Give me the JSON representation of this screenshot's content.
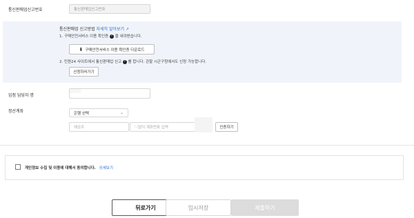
{
  "form": {
    "reg_number_label": "통신판매업신고번호",
    "reg_number_value": "통신판매업신고번호",
    "info_box": {
      "title": "통신판매업 신고방법",
      "title_link": "자세히 알아보기",
      "step1": "1. 구매안전서비스 이용 확인증",
      "step1_tail": "을 내려받습니다.",
      "download_button": "구매안전서비스 이용 확인증 다운로드",
      "step2": "2. 민원24 사이트에서 통신판매업 신고",
      "step2_tail": "를 합니다. 관할 시군구청에서도 신청 가능합니다.",
      "apply_button": "신청하러가기"
    },
    "manager_label": "입점 담당자 명",
    "settlement_label": "정산계좌",
    "bank_select": "은행 선택",
    "account_holder_placeholder": "예금주",
    "account_number_placeholder": "'-'없이 계좌번호 입력",
    "verify_button": "인증하기"
  },
  "consent": {
    "text": "개인정보 수집 및 이용에 대해서 동의합니다.",
    "link": "상세보기"
  },
  "actions": {
    "back": "뒤로가기",
    "temp_save": "임시저장",
    "submit": "제출하기"
  }
}
